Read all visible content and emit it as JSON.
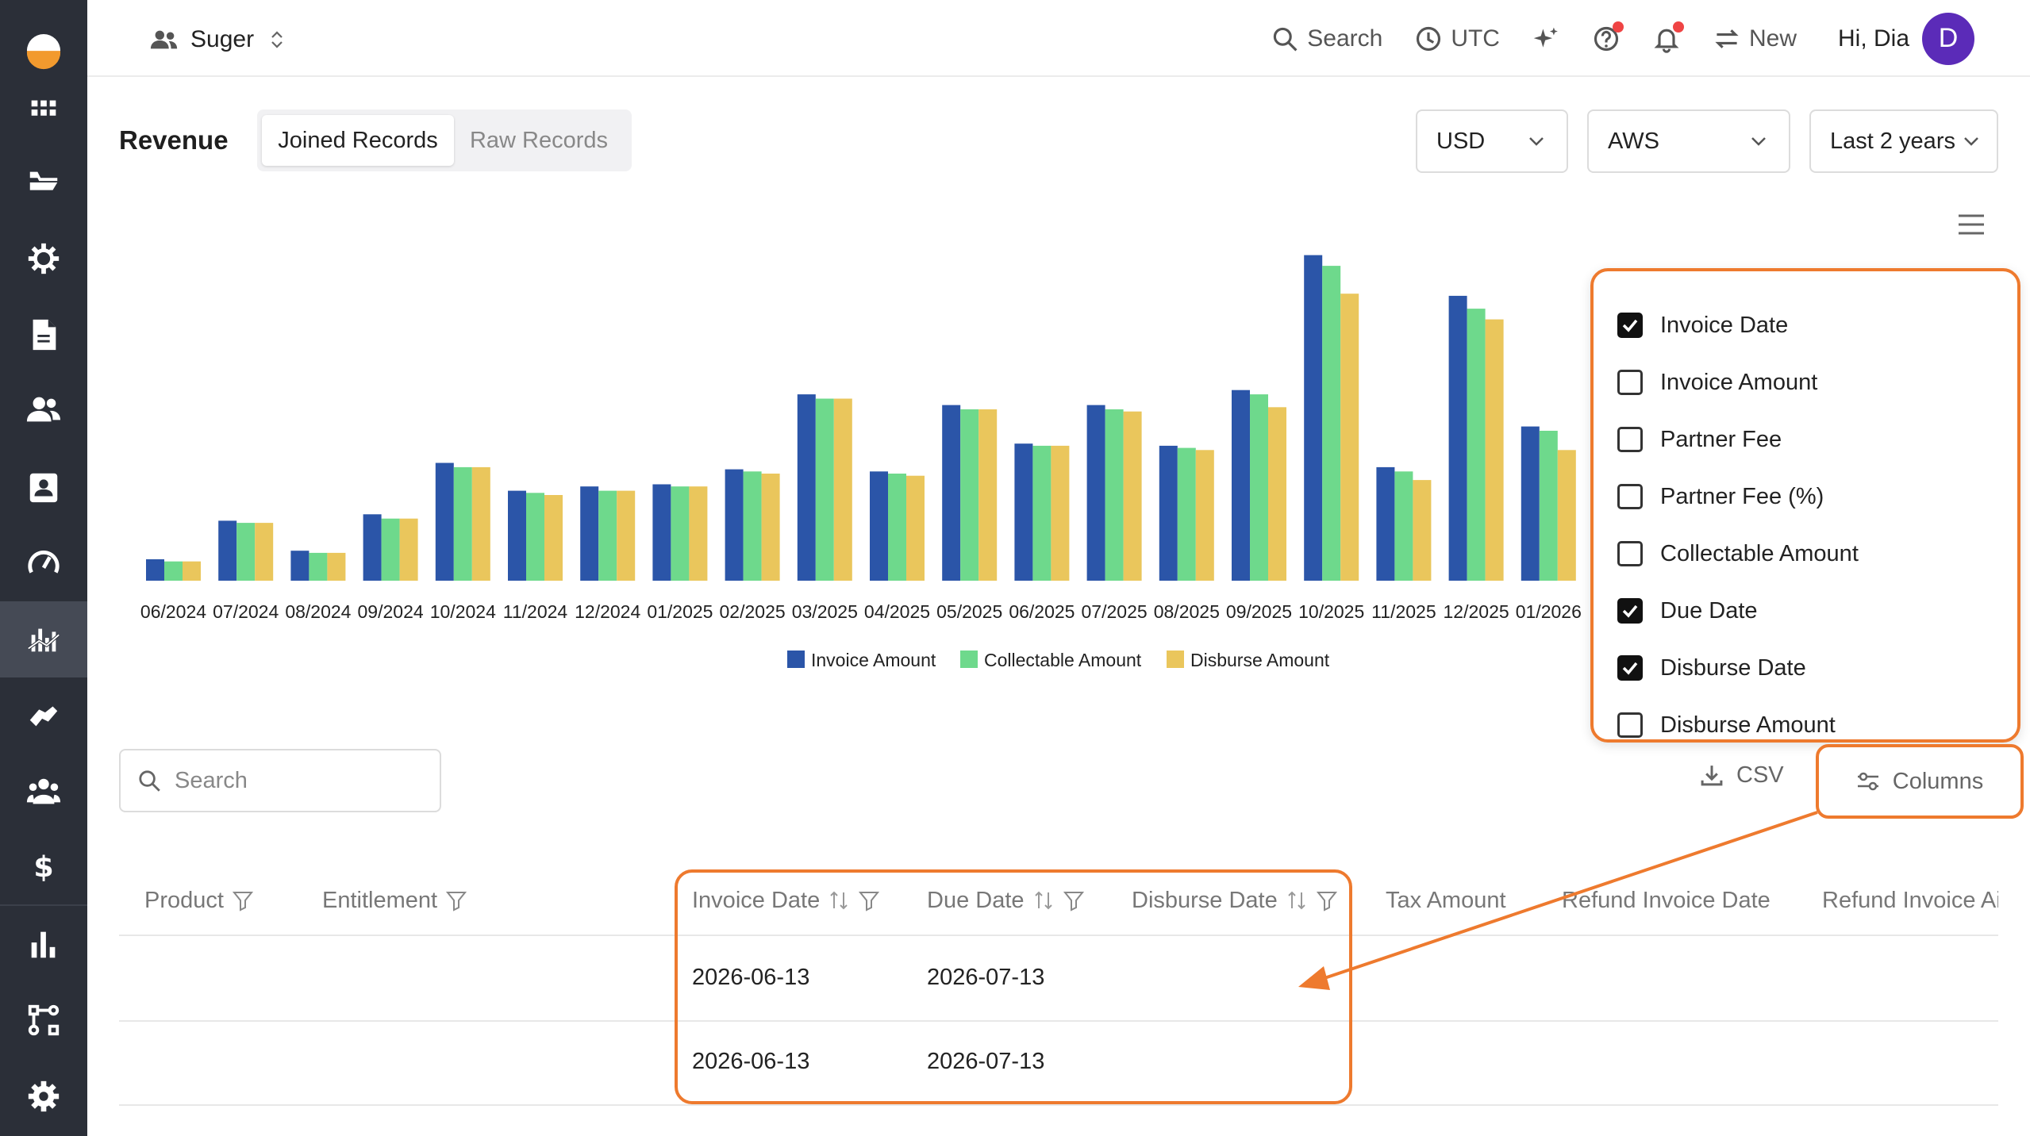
{
  "topbar": {
    "org_name": "Suger",
    "search_label": "Search",
    "timezone": "UTC",
    "new_label": "New",
    "greeting": "Hi, Dia",
    "avatar_letter": "D"
  },
  "header": {
    "title": "Revenue",
    "tabs": [
      "Joined Records",
      "Raw Records"
    ],
    "currency": "USD",
    "provider": "AWS",
    "period": "Last 2 years"
  },
  "chart_data": {
    "type": "bar",
    "categories": [
      "06/2024",
      "07/2024",
      "08/2024",
      "09/2024",
      "10/2024",
      "11/2024",
      "12/2024",
      "01/2025",
      "02/2025",
      "03/2025",
      "04/2025",
      "05/2025",
      "06/2025",
      "07/2025",
      "08/2025",
      "09/2025",
      "10/2025",
      "11/2025",
      "12/2025",
      "01/2026"
    ],
    "series": [
      {
        "name": "Invoice Amount",
        "color": "#2b55a8",
        "values": [
          10,
          28,
          14,
          31,
          55,
          42,
          44,
          45,
          52,
          87,
          51,
          82,
          64,
          82,
          63,
          89,
          152,
          53,
          133,
          72
        ]
      },
      {
        "name": "Collectable Amount",
        "color": "#6ed98c",
        "values": [
          9,
          27,
          13,
          29,
          53,
          41,
          42,
          44,
          51,
          85,
          50,
          80,
          63,
          80,
          62,
          87,
          147,
          51,
          127,
          70
        ]
      },
      {
        "name": "Disburse Amount",
        "color": "#eac65c",
        "values": [
          9,
          27,
          13,
          29,
          53,
          40,
          42,
          44,
          50,
          85,
          49,
          80,
          63,
          79,
          61,
          81,
          134,
          47,
          122,
          61
        ]
      }
    ],
    "legend_position": "bottom",
    "grid": false
  },
  "column_menu": {
    "items": [
      {
        "label": "Invoice Date",
        "checked": true
      },
      {
        "label": "Invoice Amount",
        "checked": false
      },
      {
        "label": "Partner Fee",
        "checked": false
      },
      {
        "label": "Partner Fee (%)",
        "checked": false
      },
      {
        "label": "Collectable Amount",
        "checked": false
      },
      {
        "label": "Due Date",
        "checked": true
      },
      {
        "label": "Disburse Date",
        "checked": true
      },
      {
        "label": "Disburse Amount",
        "checked": false
      }
    ]
  },
  "toolbar": {
    "search_placeholder": "Search",
    "csv_label": "CSV",
    "columns_label": "Columns"
  },
  "table": {
    "columns": [
      "Product",
      "Entitlement",
      "Invoice Date",
      "Due Date",
      "Disburse Date",
      "Tax Amount",
      "Refund Invoice Date",
      "Refund Invoice Ai"
    ],
    "rows": [
      {
        "invoice_date": "2026-06-13",
        "due_date": "2026-07-13"
      },
      {
        "invoice_date": "2026-06-13",
        "due_date": "2026-07-13"
      }
    ]
  },
  "colors": {
    "sidebar": "#2b2f38",
    "accent": "#ee7a2e",
    "avatar": "#5b2bb8"
  }
}
